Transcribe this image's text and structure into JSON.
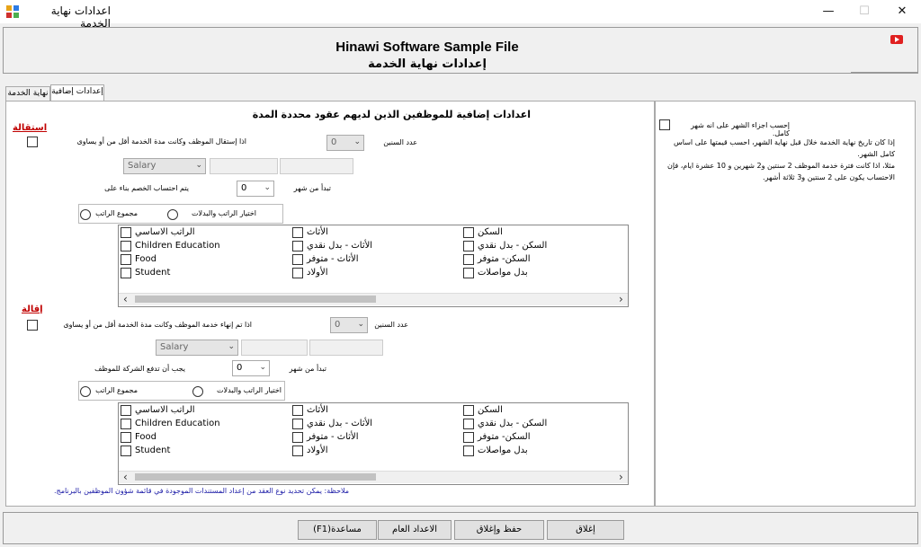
{
  "window": {
    "title": "اعدادات نهاية الخدمة",
    "minimize": "—",
    "maximize": "☐",
    "close": "✕"
  },
  "header": {
    "title_en": "Hinawi Software Sample File",
    "title_ar": "إعدادات نهاية الخدمة"
  },
  "tabs": [
    {
      "label": "نهاية الخدمة"
    },
    {
      "label": "إعدادات إضافية"
    }
  ],
  "main": {
    "heading": "اعدادات إضافية للموظفين الذين لديهم عقود محددة المدة",
    "resignation": {
      "title": "استقالة",
      "checkbox_label": "اذا إستقال الموظف وكانت مدة الخدمة أقل من أو يساوى",
      "years_label": "عدد السنين",
      "years_value": "0",
      "salary_value": "Salary",
      "start_label": "تبدأ من شهر",
      "start_value": "0",
      "calc_label": "يتم احتساب الخصم بناء على",
      "radio1": "مجموع الراتب",
      "radio2": "اختيار الراتب والبدلات",
      "col1": [
        "الراتب الاساسي",
        "Children Education",
        "Food",
        "Student"
      ],
      "col2": [
        "الأثاث",
        "الأثاث - بدل نقدي",
        "الأثاث - متوفر",
        "الأولاد"
      ],
      "col3": [
        "السكن",
        "السكن - بدل نقدي",
        "السكن- متوفر",
        "بدل مواصلات"
      ]
    },
    "termination": {
      "title": "إقالة",
      "checkbox_label": "اذا تم إنهاء خدمة الموظف وكانت مدة الخدمة أقل من أو يساوى",
      "years_label": "عدد السنين",
      "years_value": "0",
      "salary_value": "Salary",
      "start_label": "تبدأ من شهر",
      "start_value": "0",
      "calc_label": "يجب أن تدفع الشركة للموظف",
      "radio1": "مجموع الراتب",
      "radio2": "اختيار الراتب والبدلات",
      "col1": [
        "الراتب الاساسي",
        "Children Education",
        "Food",
        "Student"
      ],
      "col2": [
        "الأثاث",
        "الأثاث - بدل نقدي",
        "الأثاث - متوفر",
        "الأولاد"
      ],
      "col3": [
        "السكن",
        "السكن - بدل نقدي",
        "السكن- متوفر",
        "بدل مواصلات"
      ]
    },
    "note": "ملاحظة: يمكن تحديد نوع العقد من إعداد المستندات الموجودة في قائمة شؤون الموظفين بالبرنامج."
  },
  "right_panel": {
    "checkbox_label": "إحسب اجزاء الشهر على انه شهر كامل.",
    "desc1": "إذا كان تاريخ نهاية الخدمة خلال قبل نهاية الشهر، احسب قيمتها على اساس كامل الشهر.",
    "desc2": "مثلا، اذا كانت فترة خدمة الموظف 2 سنتين و2 شهرين و 10 عشرة ايام، فإن الاحتساب يكون على 2 سنتين و3 ثلاثة أشهر."
  },
  "buttons": {
    "close": "إغلاق",
    "save_close": "حفظ وإغلاق",
    "general": "الاعداد العام",
    "help": "مساعدة(F1)"
  },
  "colors": {
    "red_label": "#c00000",
    "note": "#1a1aa6",
    "youtube": "#e02020"
  },
  "icons": [
    "app-icon",
    "youtube-icon",
    "chevron-down-icon",
    "scroll-left-icon",
    "scroll-right-icon"
  ]
}
